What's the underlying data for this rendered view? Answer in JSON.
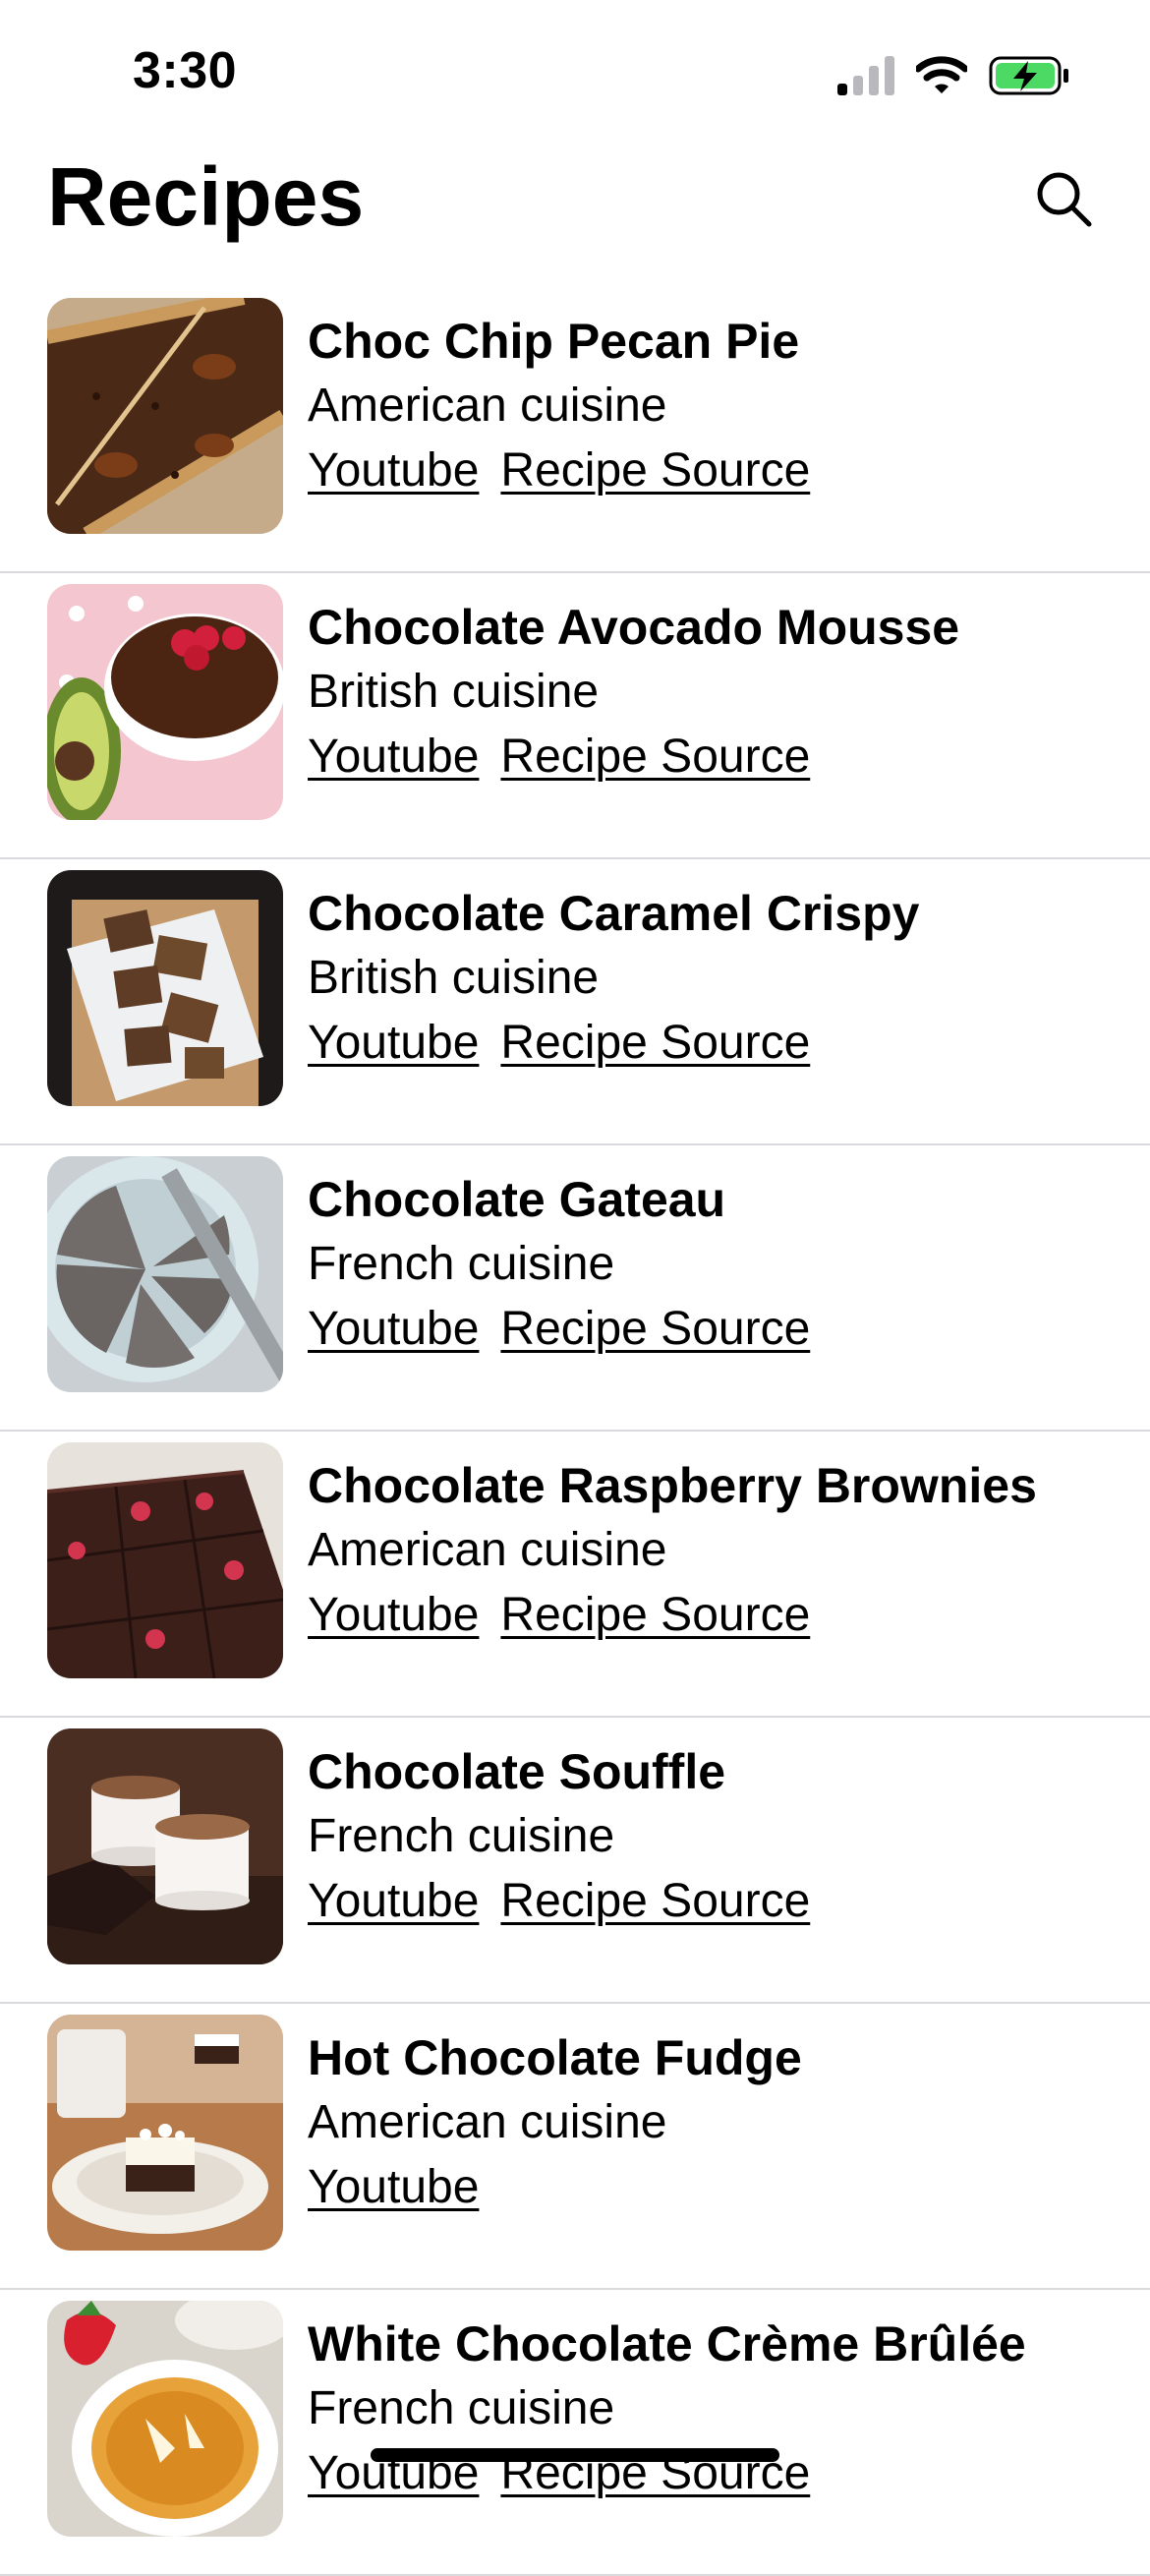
{
  "status_bar": {
    "time": "3:30",
    "icons": [
      "cellular-signal-icon",
      "wifi-icon",
      "battery-charging-icon"
    ],
    "battery_color": "#4cd964"
  },
  "header": {
    "title": "Recipes",
    "search_icon": "search-icon"
  },
  "recipes": [
    {
      "name": "Choc Chip Pecan Pie",
      "cuisine": "American cuisine",
      "links": [
        "Youtube",
        "Recipe Source"
      ]
    },
    {
      "name": "Chocolate Avocado Mousse",
      "cuisine": "British cuisine",
      "links": [
        "Youtube",
        "Recipe Source"
      ]
    },
    {
      "name": "Chocolate Caramel Crispy",
      "cuisine": "British cuisine",
      "links": [
        "Youtube",
        "Recipe Source"
      ]
    },
    {
      "name": "Chocolate Gateau",
      "cuisine": "French cuisine",
      "links": [
        "Youtube",
        "Recipe Source"
      ]
    },
    {
      "name": "Chocolate Raspberry Brownies",
      "cuisine": "American cuisine",
      "links": [
        "Youtube",
        "Recipe Source"
      ]
    },
    {
      "name": "Chocolate Souffle",
      "cuisine": "French cuisine",
      "links": [
        "Youtube",
        "Recipe Source"
      ]
    },
    {
      "name": "Hot Chocolate Fudge",
      "cuisine": "American cuisine",
      "links": [
        "Youtube"
      ]
    },
    {
      "name": "White Chocolate Crème Brûlée",
      "cuisine": "French cuisine",
      "links": [
        "Youtube",
        "Recipe Source"
      ]
    }
  ],
  "colors": {
    "background": "#ffffff",
    "text": "#000000",
    "separator": "#d9d9de"
  }
}
